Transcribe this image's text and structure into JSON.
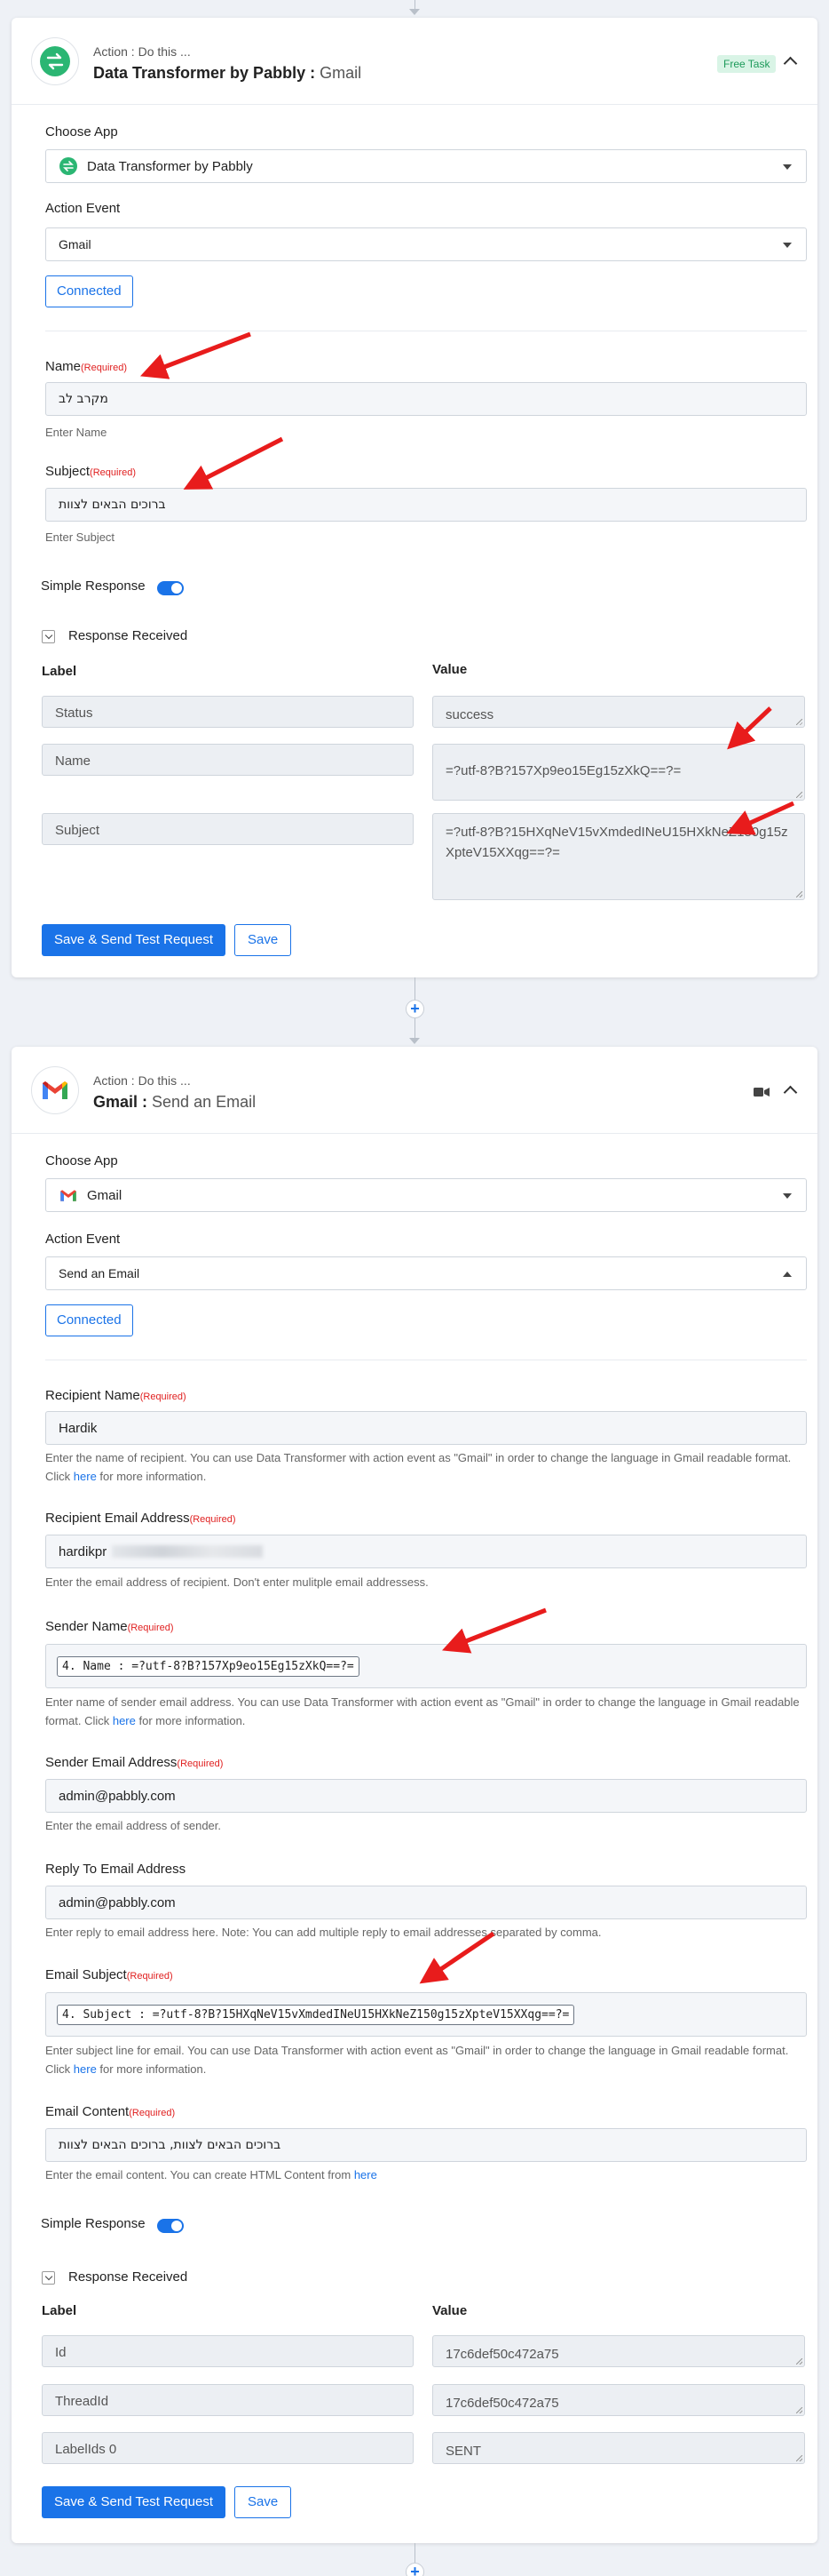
{
  "card1": {
    "action_label": "Action : Do this ...",
    "app_name": "Data Transformer by Pabbly",
    "title_sep": " : ",
    "event_name": "Gmail",
    "badge": "Free Task",
    "choose_app_label": "Choose App",
    "choose_app_value": "Data Transformer by Pabbly",
    "action_event_label": "Action Event",
    "action_event_value": "Gmail",
    "connected_label": "Connected",
    "name_label": "Name",
    "name_value": "מקרב לב",
    "name_help": "Enter Name",
    "subject_label": "Subject",
    "subject_value": "ברוכים הבאים לצוות",
    "subject_help": "Enter Subject",
    "simple_response_label": "Simple Response",
    "response_received_label": "Response Received",
    "label_header": "Label",
    "value_header": "Value",
    "rows": [
      {
        "label": "Status",
        "value": "success"
      },
      {
        "label": "Name",
        "value": "=?utf-8?B?157Xp9eo15Eg15zXkQ==?="
      },
      {
        "label": "Subject",
        "value": "=?utf-8?B?15HXqNeV15vXmdedINeU15HXkNeZ150g15zXpteV15XXqg==?="
      }
    ],
    "save_send_label": "Save & Send Test Request",
    "save_label": "Save"
  },
  "card2": {
    "action_label": "Action : Do this ...",
    "app_name": "Gmail",
    "title_sep": " : ",
    "event_name": "Send an Email",
    "choose_app_label": "Choose App",
    "choose_app_value": "Gmail",
    "action_event_label": "Action Event",
    "action_event_value": "Send an Email",
    "connected_label": "Connected",
    "recipient_name_label": "Recipient Name",
    "recipient_name_value": "Hardik",
    "recipient_name_help_pre": "Enter the name of recipient. You can use Data Transformer with action event as \"Gmail\" in order to change the language in Gmail readable format. Click ",
    "recipient_name_help_link": "here",
    "recipient_name_help_post": " for more information.",
    "recipient_email_label": "Recipient Email Address",
    "recipient_email_value": "hardikpr",
    "recipient_email_help": "Enter the email address of recipient. Don't enter mulitple email addressess.",
    "sender_name_label": "Sender Name",
    "sender_name_token": "4. Name : =?utf-8?B?157Xp9eo15Eg15zXkQ==?=",
    "sender_name_help_pre": "Enter name of sender email address. You can use Data Transformer with action event as \"Gmail\" in order to change the language in Gmail readable format. Click ",
    "sender_name_help_link": "here",
    "sender_name_help_post": " for more information.",
    "sender_email_label": "Sender Email Address",
    "sender_email_value": "admin@pabbly.com",
    "sender_email_help": "Enter the email address of sender.",
    "reply_to_label": "Reply To Email Address",
    "reply_to_value": "admin@pabbly.com",
    "reply_to_help": "Enter reply to email address here. Note: You can add multiple reply to email addresses separated by comma.",
    "email_subject_label": "Email Subject",
    "email_subject_token": "4. Subject : =?utf-8?B?15HXqNeV15vXmdedINeU15HXkNeZ150g15zXpteV15XXqg==?=",
    "email_subject_help_pre": "Enter subject line for email. You can use Data Transformer with action event as \"Gmail\" in order to change the language in Gmail readable format. Click ",
    "email_subject_help_link": "here",
    "email_subject_help_post": " for more information.",
    "email_content_label": "Email Content",
    "email_content_value": "ברוכים הבאים לצוות, ברוכים הבאים לצוות",
    "email_content_help_pre": "Enter the email content. You can create HTML Content from ",
    "email_content_help_link": "here",
    "simple_response_label": "Simple Response",
    "response_received_label": "Response Received",
    "label_header": "Label",
    "value_header": "Value",
    "rows": [
      {
        "label": "Id",
        "value": "17c6def50c472a75"
      },
      {
        "label": "ThreadId",
        "value": "17c6def50c472a75"
      },
      {
        "label": "LabelIds 0",
        "value": "SENT"
      }
    ],
    "save_send_label": "Save & Send Test Request",
    "save_label": "Save"
  },
  "required_text": "(Required)",
  "plus_symbol": "+",
  "icons": {
    "transformer": "transformer-icon",
    "gmail": "gmail-icon",
    "video": "video-camera-icon",
    "collapse": "chevron-up-icon",
    "annotation": "red-arrow-icon"
  },
  "colors": {
    "primary": "#1a73e8",
    "required": "#e02020",
    "transformer_green": "#2bb673",
    "annotation_red": "#e81c1c"
  }
}
